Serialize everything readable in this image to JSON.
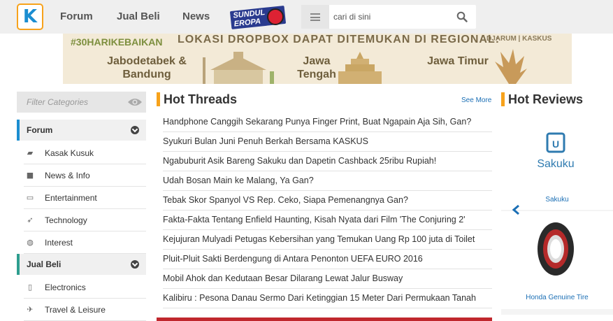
{
  "header": {
    "logo": "K",
    "nav": {
      "forum": "Forum",
      "jual_beli": "Jual Beli",
      "news": "News"
    },
    "promo_badge": "SUNDUL EROPA",
    "search": {
      "placeholder": "cari di sini"
    }
  },
  "banner": {
    "hashtag": "#30HARIKEBAIKAN",
    "headline": "LOKASI DROPBOX DAPAT DITEMUKAN DI REGIONAL:",
    "sponsor": "DJARUM | KASKUS",
    "regions": [
      "Jabodetabek & Bandung",
      "Jawa Tengah",
      "Jawa Timur"
    ]
  },
  "sidebar": {
    "filter_placeholder": "Filter Categories",
    "forum": {
      "label": "Forum",
      "items": [
        {
          "label": "Kasak Kusuk",
          "icon": "chat-icon"
        },
        {
          "label": "News & Info",
          "icon": "briefcase-icon"
        },
        {
          "label": "Entertainment",
          "icon": "tv-icon"
        },
        {
          "label": "Technology",
          "icon": "rocket-icon"
        },
        {
          "label": "Interest",
          "icon": "palette-icon"
        }
      ]
    },
    "jual_beli": {
      "label": "Jual Beli",
      "items": [
        {
          "label": "Electronics",
          "icon": "phone-icon"
        },
        {
          "label": "Travel & Leisure",
          "icon": "plane-icon"
        }
      ]
    }
  },
  "hot_threads": {
    "title": "Hot Threads",
    "see_more": "See More",
    "items": [
      "Handphone Canggih Sekarang Punya Finger Print, Buat Ngapain Aja Sih, Gan?",
      "Syukuri Bulan Juni Penuh Berkah Bersama KASKUS",
      "Ngabuburit Asik Bareng Sakuku dan Dapetin Cashback 25ribu Rupiah!",
      "Udah Bosan Main ke Malang, Ya Gan?",
      "Tebak Skor Spanyol VS Rep. Ceko, Siapa Pemenangnya Gan?",
      "Fakta-Fakta Tentang Enfield Haunting, Kisah Nyata dari Film 'The Conjuring 2'",
      "Kejujuran Mulyadi Petugas Kebersihan yang Temukan Uang Rp 100 juta di Toilet",
      "Pluit-Pluit Sakti Berdengung di Antara Penonton UEFA EURO 2016",
      "Mobil Ahok dan Kedutaan Besar Dilarang Lewat Jalur Busway",
      "Kalibiru : Pesona Danau Sermo Dari Ketinggian 15 Meter Dari Permukaan Tanah"
    ]
  },
  "hot_reviews": {
    "title": "Hot Reviews",
    "items": [
      {
        "name": "Sakuku",
        "logo_text": "Sakuku"
      },
      {
        "name": "Honda Genuine Tire"
      }
    ]
  },
  "colors": {
    "accent": "#f7a21b",
    "link": "#1b6fb5",
    "brand_blue": "#1b8ed1"
  }
}
